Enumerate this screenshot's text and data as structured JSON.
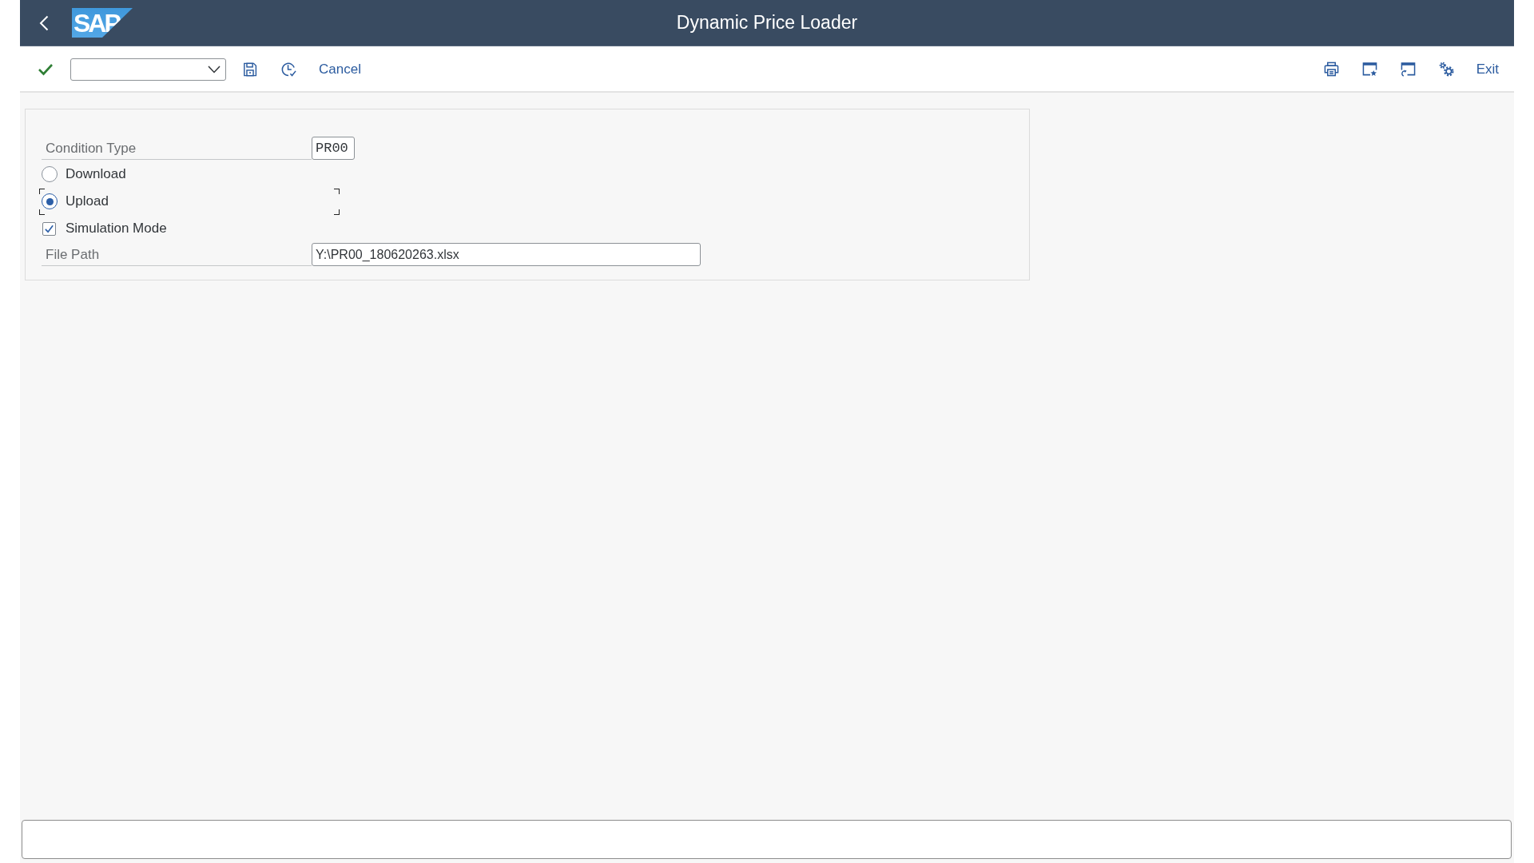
{
  "header": {
    "logo": "SAP",
    "title": "Dynamic Price Loader"
  },
  "toolbar": {
    "cancel": "Cancel",
    "exit": "Exit"
  },
  "form": {
    "condition_type": {
      "label": "Condition Type",
      "value": "PR00"
    },
    "mode_options": [
      {
        "label": "Download",
        "selected": false,
        "focused": false
      },
      {
        "label": "Upload",
        "selected": true,
        "focused": true
      }
    ],
    "simulation_mode": {
      "label": "Simulation Mode",
      "checked": true
    },
    "file_path": {
      "label": "File Path",
      "value": "Y:\\PR00_180620263.xlsx"
    }
  }
}
